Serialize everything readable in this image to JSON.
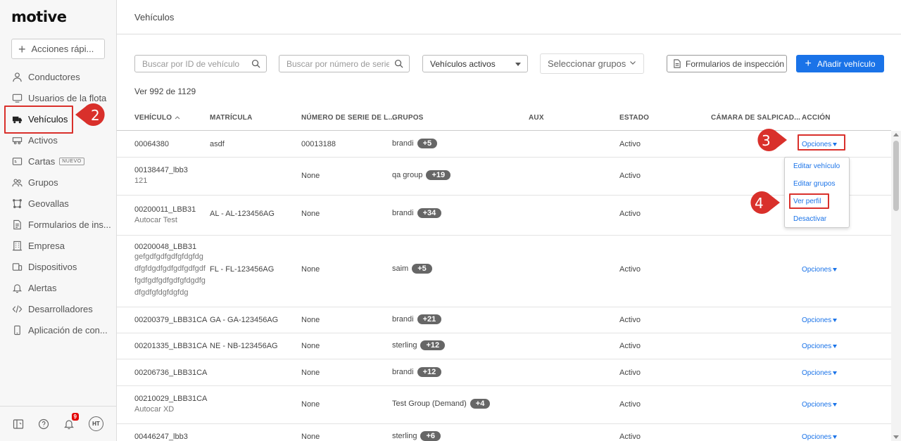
{
  "app": {
    "logo": "motive"
  },
  "sidebar": {
    "quick_actions": "Acciones rápi...",
    "items": [
      {
        "label": "Conductores",
        "icon": "person-icon"
      },
      {
        "label": "Usuarios de la flota",
        "icon": "monitor-icon"
      },
      {
        "label": "Vehículos",
        "icon": "truck-icon"
      },
      {
        "label": "Activos",
        "icon": "trailer-icon"
      },
      {
        "label": "Cartas",
        "icon": "map-card-icon",
        "badge": "NUEVO"
      },
      {
        "label": "Grupos",
        "icon": "group-icon"
      },
      {
        "label": "Geovallas",
        "icon": "geofence-icon"
      },
      {
        "label": "Formularios de ins...",
        "icon": "document-icon"
      },
      {
        "label": "Empresa",
        "icon": "building-icon"
      },
      {
        "label": "Dispositivos",
        "icon": "devices-icon"
      },
      {
        "label": "Alertas",
        "icon": "bell-icon"
      },
      {
        "label": "Desarrolladores",
        "icon": "code-icon"
      },
      {
        "label": "Aplicación de con...",
        "icon": "phone-icon"
      }
    ],
    "footer": {
      "notifications": "9",
      "avatar": "HT"
    }
  },
  "header": {
    "title": "Vehículos"
  },
  "toolbar": {
    "search_id_placeholder": "Buscar por ID de vehículo",
    "search_serial_placeholder": "Buscar por número de serie d",
    "status_select": "Vehículos activos",
    "groups_select": "Seleccionar grupos",
    "inspection_forms": "Formularios de inspección",
    "add_vehicle": "Añadir vehículo"
  },
  "count_text": "Ver 992 de 1129",
  "table": {
    "headers": {
      "vehicle": "VEHÍCULO",
      "plate": "MATRÍCULA",
      "serial": "NÚMERO DE SERIE DE L...",
      "groups": "GRUPOS",
      "aux": "AUX",
      "status": "ESTADO",
      "camera": "CÁMARA DE SALPICAD...",
      "action": "ACCIÓN"
    },
    "rows": [
      {
        "vehicle": [
          "00064380"
        ],
        "sub": [],
        "plate": "asdf",
        "serial": "00013188",
        "group": "brandi",
        "more": "+5",
        "status": "Activo",
        "action": "Opciones"
      },
      {
        "vehicle": [
          "00138447_lbb3"
        ],
        "sub": [
          "121"
        ],
        "plate": "",
        "serial": "None",
        "group": "qa group",
        "more": "+19",
        "status": "Activo",
        "action": ""
      },
      {
        "vehicle": [
          "00200011_LBB31"
        ],
        "sub": [
          "Autocar Test"
        ],
        "plate": "AL - AL-123456AG",
        "serial": "None",
        "group": "brandi",
        "more": "+34",
        "status": "Activo",
        "action": ""
      },
      {
        "vehicle": [
          "00200048_LBB31"
        ],
        "sub": [
          "gefgdfgdfgdfgfdgfdg",
          "dfgfdgdfgdfgdfgdfgdf",
          "fgdfgdfgdfgdfgfdgdfg",
          "dfgdfgfdgfdgfdg"
        ],
        "plate": "FL - FL-123456AG",
        "serial": "None",
        "group": "saim",
        "more": "+5",
        "status": "Activo",
        "action": "Opciones"
      },
      {
        "vehicle": [
          "00200379_LBB31CA"
        ],
        "sub": [],
        "plate": "GA - GA-123456AG",
        "serial": "None",
        "group": "brandi",
        "more": "+21",
        "status": "Activo",
        "action": "Opciones"
      },
      {
        "vehicle": [
          "00201335_LBB31CA"
        ],
        "sub": [],
        "plate": "NE - NB-123456AG",
        "serial": "None",
        "group": "sterling",
        "more": "+12",
        "status": "Activo",
        "action": "Opciones"
      },
      {
        "vehicle": [
          "00206736_LBB31CA"
        ],
        "sub": [],
        "plate": "",
        "serial": "None",
        "group": "brandi",
        "more": "+12",
        "status": "Activo",
        "action": "Opciones"
      },
      {
        "vehicle": [
          "00210029_LBB31CA"
        ],
        "sub": [
          "Autocar XD"
        ],
        "plate": "",
        "serial": "None",
        "group": "Test Group (Demand)",
        "more": "+4",
        "status": "Activo",
        "action": "Opciones"
      },
      {
        "vehicle": [
          "00446247_lbb3"
        ],
        "sub": [],
        "plate": "",
        "serial": "None",
        "group": "sterling",
        "more": "+6",
        "status": "Activo",
        "action": "Opciones"
      }
    ]
  },
  "dropdown": {
    "items": [
      "Editar vehículo",
      "Editar grupos",
      "Ver perfil",
      "Desactivar"
    ]
  },
  "callouts": {
    "two": "2",
    "three": "3",
    "four": "4"
  },
  "colors": {
    "accent": "#1a73e8",
    "highlight": "#d9302b"
  }
}
